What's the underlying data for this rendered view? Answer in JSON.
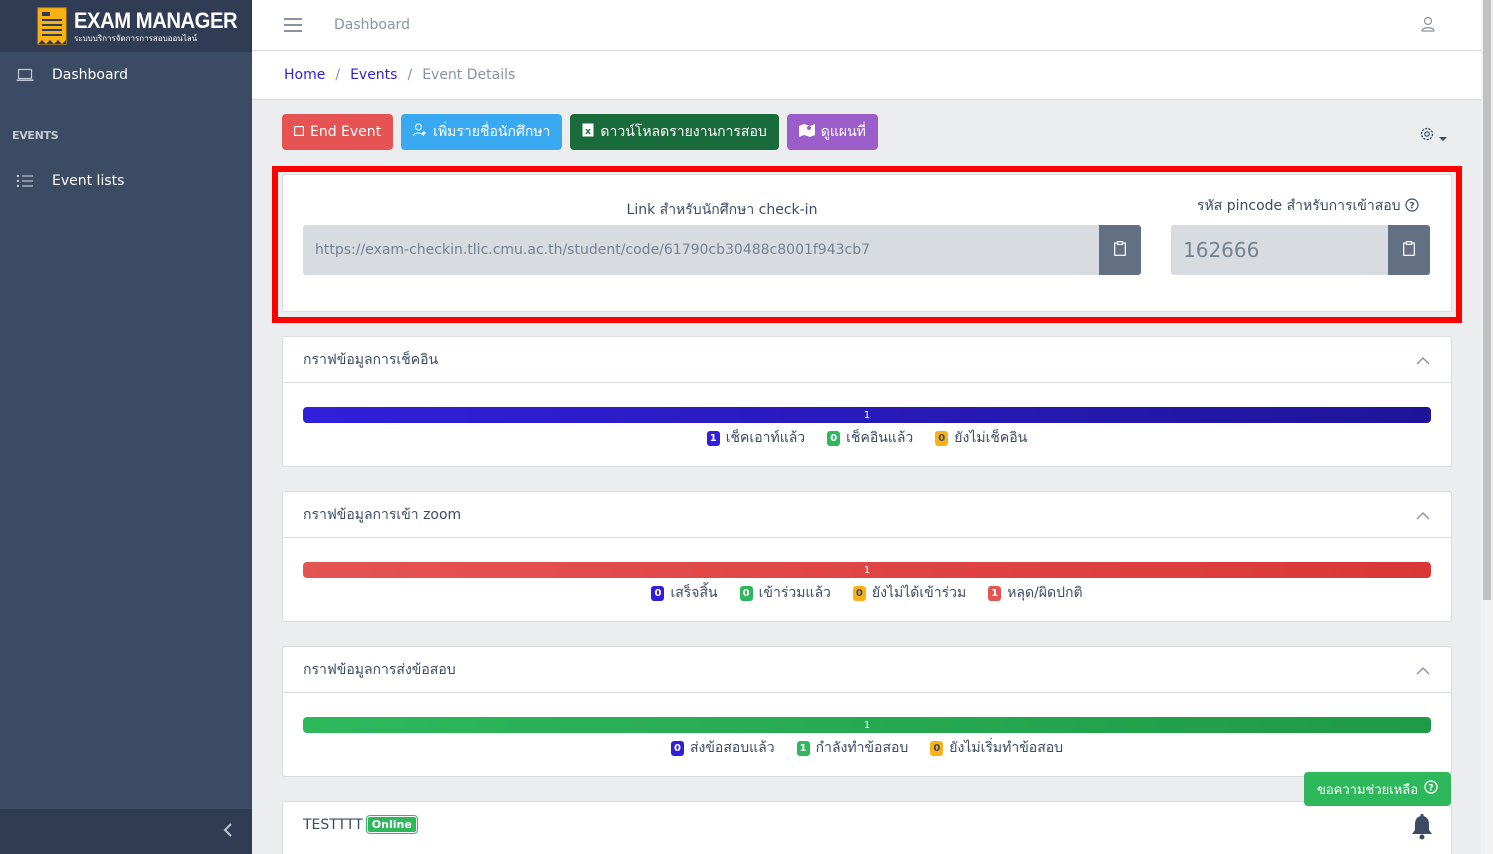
{
  "brand": {
    "title": "EXAM MANAGER",
    "subtitle": "ระบบบริการจัดการการสอบออนไลน์"
  },
  "sidebar": {
    "items": [
      {
        "label": "Dashboard",
        "icon": "laptop-icon"
      }
    ],
    "section_title": "EVENTS",
    "section_items": [
      {
        "label": "Event lists",
        "icon": "list-icon"
      }
    ]
  },
  "header": {
    "link": "Dashboard"
  },
  "breadcrumb": {
    "home": "Home",
    "events": "Events",
    "current": "Event Details",
    "separator": "/"
  },
  "toolbar": {
    "end_event": "End Event",
    "add_students": "เพิ่มรายชื่อนักศึกษา",
    "download_report": "ดาวน์โหลดรายงานการสอบ",
    "view_map": "ดูแผนที่"
  },
  "checkin": {
    "link_label": "Link สำหรับนักศึกษา check-in",
    "link_value": "https://exam-checkin.tlic.cmu.ac.th/student/code/61790cb30488c8001f943cb7",
    "pin_label": "รหัส pincode สำหรับการเข้าสอบ",
    "pin_value": "162666"
  },
  "cards": [
    {
      "title": "กราฟข้อมูลการเช็คอิน",
      "bar_label": "1",
      "bar_color": "#321fdb",
      "legend": [
        {
          "count": "1",
          "label": "เช็คเอาท์แล้ว",
          "color": "primary"
        },
        {
          "count": "0",
          "label": "เช็คอินแล้ว",
          "color": "success"
        },
        {
          "count": "0",
          "label": "ยังไม่เช็คอิน",
          "color": "warning"
        }
      ]
    },
    {
      "title": "กราฟข้อมูลการเข้า zoom",
      "bar_label": "1",
      "bar_color": "#e55353",
      "legend": [
        {
          "count": "0",
          "label": "เสร็จสิ้น",
          "color": "primary"
        },
        {
          "count": "0",
          "label": "เข้าร่วมแล้ว",
          "color": "success"
        },
        {
          "count": "0",
          "label": "ยังไม่ได้เข้าร่วม",
          "color": "warning"
        },
        {
          "count": "1",
          "label": "หลุด/ผิดปกติ",
          "color": "danger"
        }
      ]
    },
    {
      "title": "กราฟข้อมูลการส่งข้อสอบ",
      "bar_label": "1",
      "bar_color": "#2eb85c",
      "legend": [
        {
          "count": "0",
          "label": "ส่งข้อสอบแล้ว",
          "color": "primary"
        },
        {
          "count": "1",
          "label": "กำลังทำข้อสอบ",
          "color": "success"
        },
        {
          "count": "0",
          "label": "ยังไม่เริ่มทำข้อสอบ",
          "color": "warning"
        }
      ]
    }
  ],
  "participant": {
    "name": "TESTTTT",
    "status": "Online"
  },
  "help": {
    "label": "ขอความช่วยเหลือ"
  },
  "colors": {
    "sidebar": "#3c4b64",
    "highlight": "#ff0000",
    "primary": "#321fdb",
    "success": "#2eb85c",
    "danger": "#e55353",
    "warning": "#f9b115"
  }
}
